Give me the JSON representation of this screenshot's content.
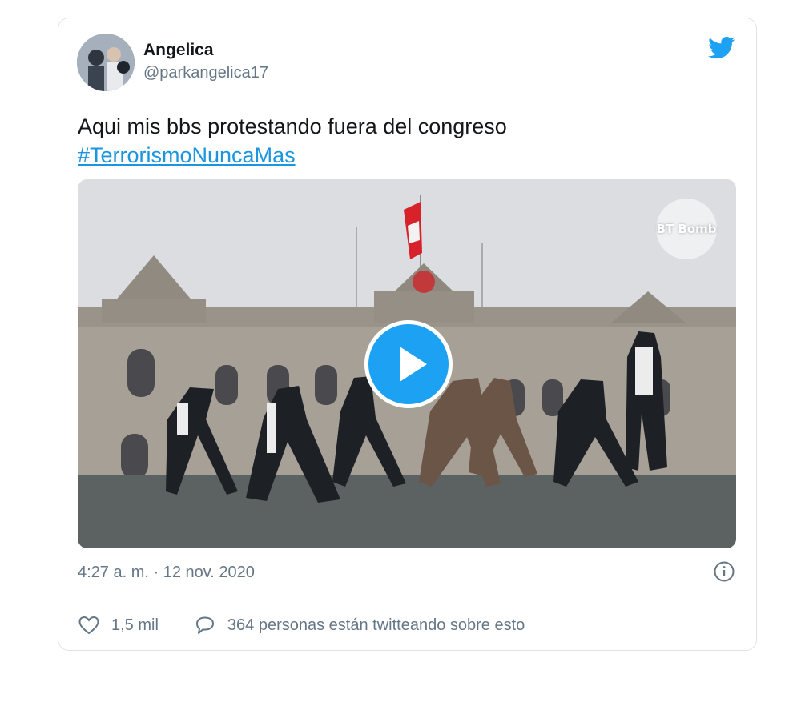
{
  "author": {
    "name": "Angelica",
    "handle": "@parkangelica17"
  },
  "tweet": {
    "text": "Aqui mis bbs protestando fuera del congreso",
    "hashtag": "#TerrorismoNuncaMas"
  },
  "media": {
    "type": "video",
    "watermark": "BT Bomb"
  },
  "meta": {
    "timestamp": "4:27 a. m. · 12 nov. 2020"
  },
  "footer": {
    "likes": "1,5 mil",
    "talking": "364 personas están twitteando sobre esto"
  },
  "icons": {
    "twitter": "twitter-bird-icon",
    "info": "info-icon",
    "like": "heart-icon",
    "reply": "speech-bubble-icon",
    "play": "play-icon"
  },
  "colors": {
    "brand": "#1da1f2",
    "link": "#1b95e0",
    "secondary_text": "#657786",
    "border": "#dfe3e8"
  }
}
